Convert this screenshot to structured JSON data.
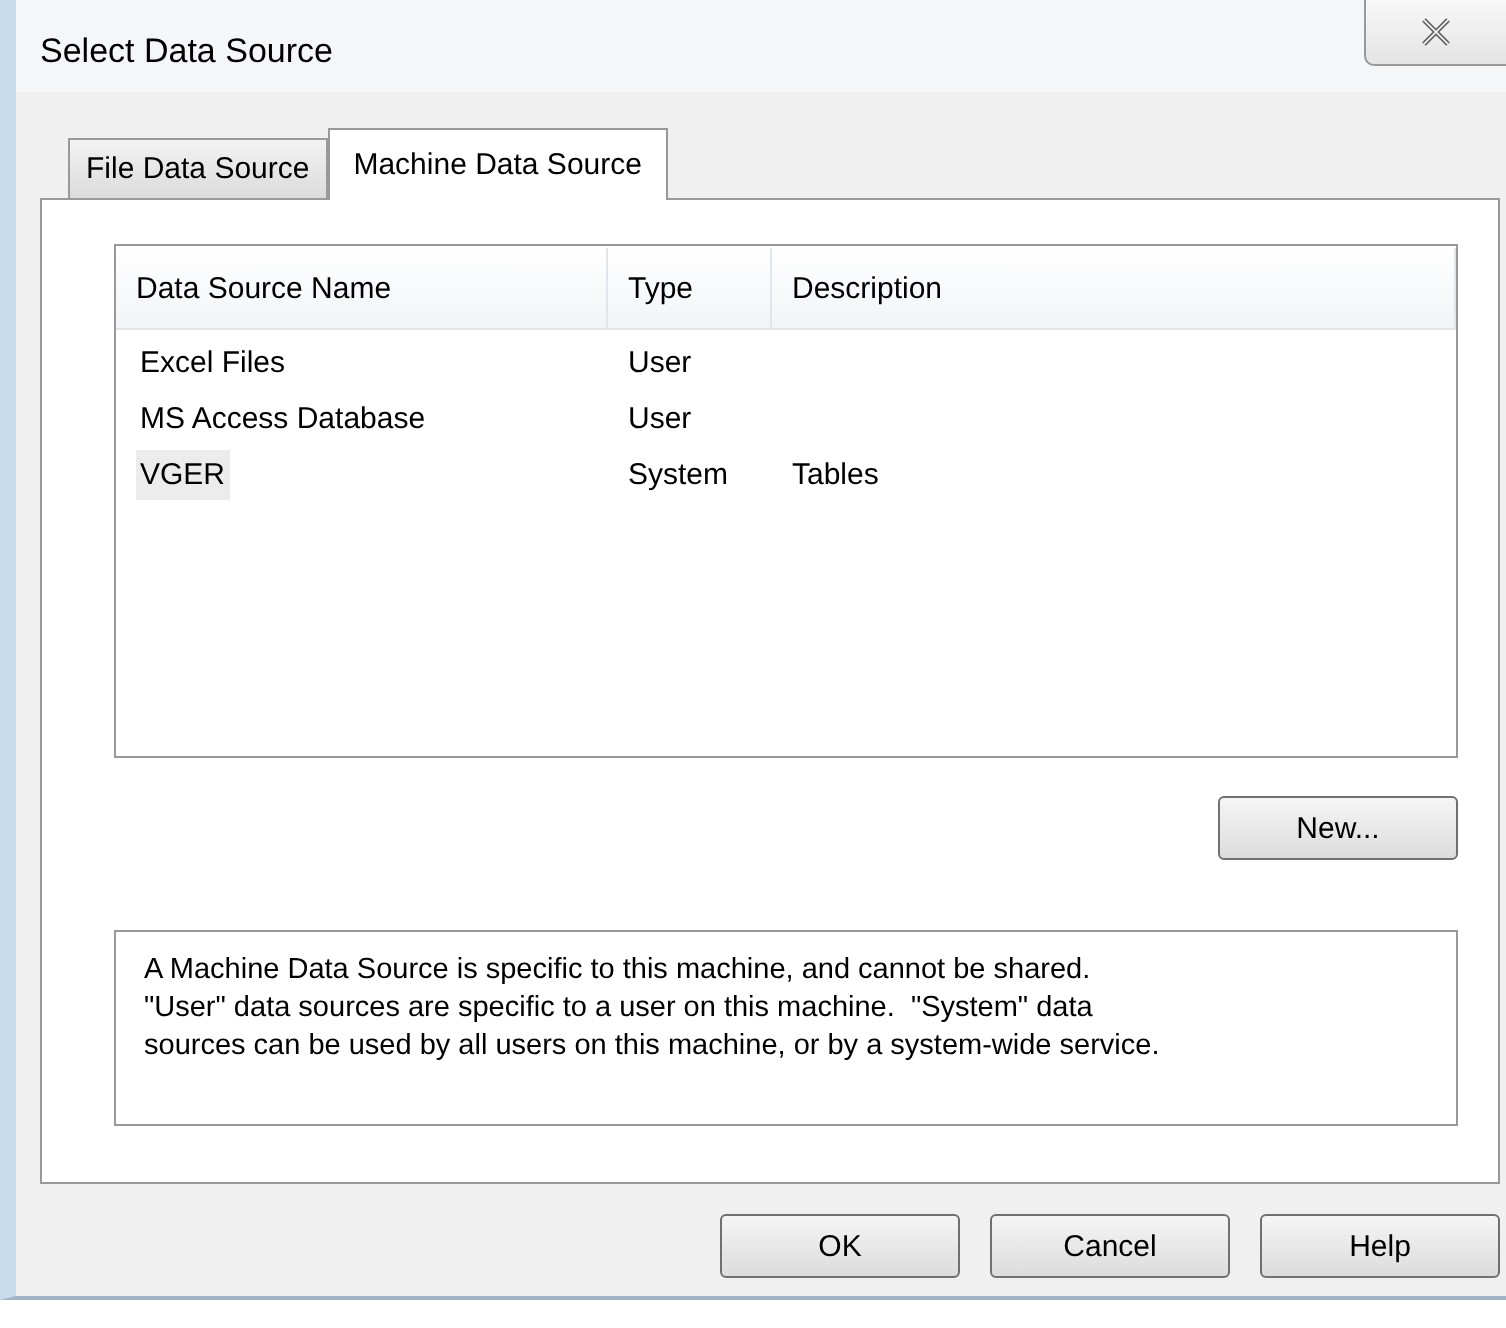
{
  "window": {
    "title": "Select Data Source"
  },
  "tabs": [
    {
      "label": "File Data Source",
      "selected": false
    },
    {
      "label": "Machine Data Source",
      "selected": true
    }
  ],
  "table": {
    "columns": [
      "Data Source Name",
      "Type",
      "Description"
    ],
    "rows": [
      {
        "name": "Excel Files",
        "type": "User",
        "selected": false
      },
      {
        "name": "MS Access Database",
        "type": "User",
        "selected": false
      },
      {
        "name": "VGER",
        "type": "System",
        "description": "Tables",
        "selected": true
      }
    ]
  },
  "new_button": "New...",
  "description": "A Machine Data Source is specific to this machine, and cannot be shared.\n\"User\" data sources are specific to a user on this machine.  \"System\" data\nsources can be used by all users on this machine, or by a system-wide service.",
  "buttons": [
    "OK",
    "Cancel",
    "Help"
  ]
}
